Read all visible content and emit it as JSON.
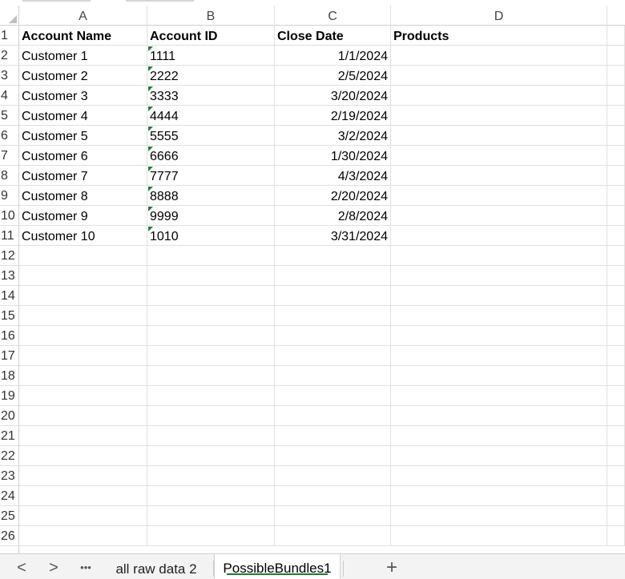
{
  "columns": [
    "A",
    "B",
    "C",
    "D"
  ],
  "header_row": [
    "Account Name",
    "Account ID",
    "Close Date",
    "Products"
  ],
  "rows": [
    {
      "num": "1"
    },
    {
      "num": "2",
      "a": "Customer 1",
      "b": "1111",
      "c": "1/1/2024",
      "d": ""
    },
    {
      "num": "3",
      "a": "Customer 2",
      "b": "2222",
      "c": "2/5/2024",
      "d": ""
    },
    {
      "num": "4",
      "a": "Customer 3",
      "b": "3333",
      "c": "3/20/2024",
      "d": ""
    },
    {
      "num": "5",
      "a": "Customer 4",
      "b": "4444",
      "c": "2/19/2024",
      "d": ""
    },
    {
      "num": "6",
      "a": "Customer 5",
      "b": "5555",
      "c": "3/2/2024",
      "d": ""
    },
    {
      "num": "7",
      "a": "Customer 6",
      "b": "6666",
      "c": "1/30/2024",
      "d": ""
    },
    {
      "num": "8",
      "a": "Customer 7",
      "b": "7777",
      "c": "4/3/2024",
      "d": ""
    },
    {
      "num": "9",
      "a": "Customer 8",
      "b": "8888",
      "c": "2/20/2024",
      "d": ""
    },
    {
      "num": "10",
      "a": "Customer 9",
      "b": "9999",
      "c": "2/8/2024",
      "d": ""
    },
    {
      "num": "11",
      "a": "Customer 10",
      "b": "1010",
      "c": "3/31/2024",
      "d": ""
    }
  ],
  "empty_row_numbers": [
    "12",
    "13",
    "14",
    "15",
    "16",
    "17",
    "18",
    "19",
    "20",
    "21",
    "22",
    "23",
    "24",
    "25",
    "26"
  ],
  "sheet_tabs": {
    "prev_icon": "chevron-left-icon",
    "prev": "<",
    "next_icon": "chevron-right-icon",
    "next": ">",
    "more_icon": "more-horizontal-icon",
    "more": "•••",
    "tabs": [
      {
        "label": "all raw data 2",
        "active": false
      },
      {
        "label": "PossibleBundles1",
        "active": true
      }
    ],
    "add_icon": "plus-icon",
    "add": "+"
  },
  "colors": {
    "active_tab_underline": "#1e7b33",
    "error_flag": "#1e7b33",
    "gridline": "#e1e1e1"
  }
}
